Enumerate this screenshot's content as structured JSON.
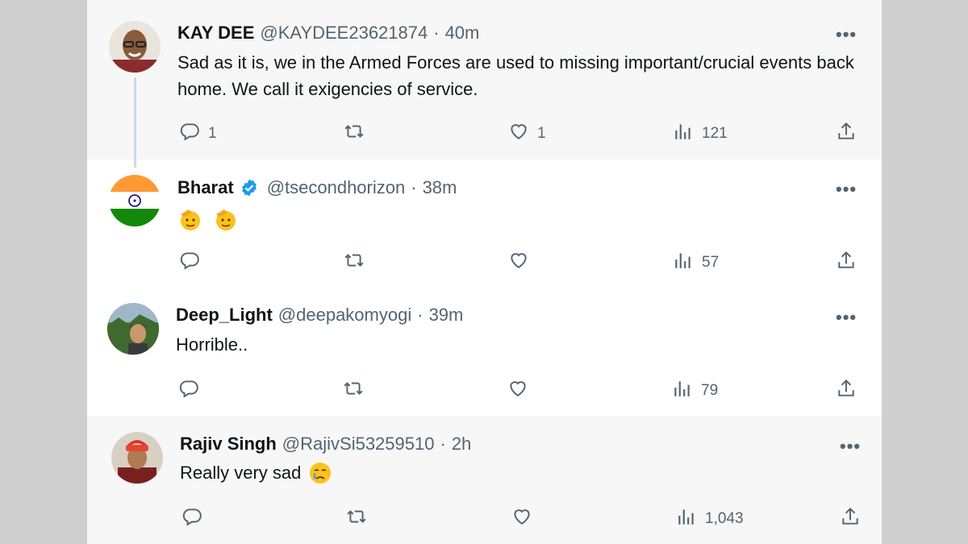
{
  "tweets": [
    {
      "name": "KAY DEE",
      "handle": "@KAYDEE23621874",
      "time": "40m",
      "text": "Sad as it is, we in the Armed Forces are used to missing important/crucial events back home. We call it exigencies of service.",
      "replies": "1",
      "retweets": "",
      "likes": "1",
      "views": "121"
    },
    {
      "name": "Bharat",
      "handle": "@tsecondhorizon",
      "time": "38m",
      "text": "",
      "emojis": [
        "saluting-face-emoji",
        "saluting-face-emoji"
      ],
      "replies": "",
      "retweets": "",
      "likes": "",
      "views": "57"
    },
    {
      "name": "Deep_Light",
      "handle": "@deepakomyogi",
      "time": "39m",
      "text": "Horrible..",
      "replies": "",
      "retweets": "",
      "likes": "",
      "views": "79"
    },
    {
      "name": "Rajiv Singh",
      "handle": "@RajivSi53259510",
      "time": "2h",
      "text": "Really very sad",
      "emojis": [
        "crying-face-emoji"
      ],
      "replies": "",
      "retweets": "",
      "likes": "",
      "views": "1,043"
    }
  ],
  "separator": "·",
  "more_label": "•••",
  "colors": {
    "verified_badge": "#1d9bf0",
    "text_primary": "#0f1419",
    "text_secondary": "#536471",
    "shaded_row": "#f7f7f7",
    "side_background": "#cfcfcf"
  },
  "icons": [
    "reply-icon",
    "retweet-icon",
    "like-icon",
    "views-icon",
    "share-icon",
    "more-icon",
    "verified-badge-icon"
  ]
}
